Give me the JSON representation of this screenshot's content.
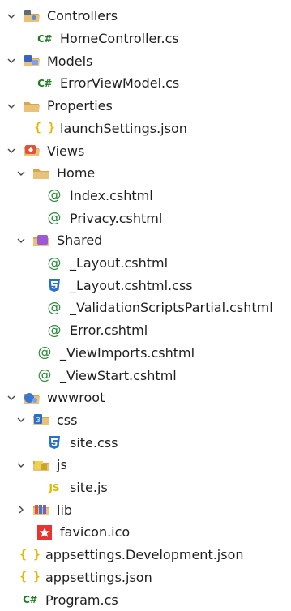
{
  "tree": [
    {
      "label": "Controllers",
      "kind": "folder",
      "icon": "controllers-folder-icon",
      "expanded": true,
      "depth": 0
    },
    {
      "label": "HomeController.cs",
      "kind": "file",
      "icon": "csharp-file-icon",
      "depth": 1
    },
    {
      "label": "Models",
      "kind": "folder",
      "icon": "models-folder-icon",
      "expanded": true,
      "depth": 0
    },
    {
      "label": "ErrorViewModel.cs",
      "kind": "file",
      "icon": "csharp-file-icon",
      "depth": 1
    },
    {
      "label": "Properties",
      "kind": "folder",
      "icon": "properties-folder-icon",
      "expanded": true,
      "depth": 0
    },
    {
      "label": "launchSettings.json",
      "kind": "file",
      "icon": "json-file-icon",
      "depth": 1
    },
    {
      "label": "Views",
      "kind": "folder",
      "icon": "views-folder-icon",
      "expanded": true,
      "depth": 0
    },
    {
      "label": "Home",
      "kind": "folder",
      "icon": "folder-icon",
      "expanded": true,
      "depth": 1
    },
    {
      "label": "Index.cshtml",
      "kind": "file",
      "icon": "razor-file-icon",
      "depth": 2
    },
    {
      "label": "Privacy.cshtml",
      "kind": "file",
      "icon": "razor-file-icon",
      "depth": 2
    },
    {
      "label": "Shared",
      "kind": "folder",
      "icon": "shared-folder-icon",
      "expanded": true,
      "depth": 1
    },
    {
      "label": "_Layout.cshtml",
      "kind": "file",
      "icon": "razor-file-icon",
      "depth": 2
    },
    {
      "label": "_Layout.cshtml.css",
      "kind": "file",
      "icon": "css-file-icon",
      "depth": 2
    },
    {
      "label": "_ValidationScriptsPartial.cshtml",
      "kind": "file",
      "icon": "razor-file-icon",
      "depth": 2
    },
    {
      "label": "Error.cshtml",
      "kind": "file",
      "icon": "razor-file-icon",
      "depth": 2
    },
    {
      "label": "_ViewImports.cshtml",
      "kind": "file",
      "icon": "razor-file-icon",
      "depth": 1
    },
    {
      "label": "_ViewStart.cshtml",
      "kind": "file",
      "icon": "razor-file-icon",
      "depth": 1
    },
    {
      "label": "wwwroot",
      "kind": "folder",
      "icon": "wwwroot-folder-icon",
      "expanded": true,
      "depth": 0
    },
    {
      "label": "css",
      "kind": "folder",
      "icon": "css-folder-icon",
      "expanded": true,
      "depth": 1
    },
    {
      "label": "site.css",
      "kind": "file",
      "icon": "css-file-icon",
      "depth": 2
    },
    {
      "label": "js",
      "kind": "folder",
      "icon": "js-folder-icon",
      "expanded": true,
      "depth": 1
    },
    {
      "label": "site.js",
      "kind": "file",
      "icon": "js-file-icon",
      "depth": 2
    },
    {
      "label": "lib",
      "kind": "folder",
      "icon": "lib-folder-icon",
      "expanded": false,
      "depth": 1
    },
    {
      "label": "favicon.ico",
      "kind": "file",
      "icon": "favicon-file-icon",
      "depth": 1
    },
    {
      "label": "appsettings.Development.json",
      "kind": "file",
      "icon": "json-file-icon",
      "depth": 0
    },
    {
      "label": "appsettings.json",
      "kind": "file",
      "icon": "json-file-icon",
      "depth": 0
    },
    {
      "label": "Program.cs",
      "kind": "file",
      "icon": "csharp-file-icon",
      "depth": 0
    }
  ],
  "glyphs": {
    "csharp": "C#",
    "json": "{ }",
    "razor": "@",
    "js": "JS"
  },
  "colors": {
    "csharp": "#1f7a1f",
    "json": "#e0b800",
    "razor": "#2f8a3d",
    "css": "#2a6fc9",
    "favicon": "#e8332e",
    "folder": "#dcb26a"
  }
}
